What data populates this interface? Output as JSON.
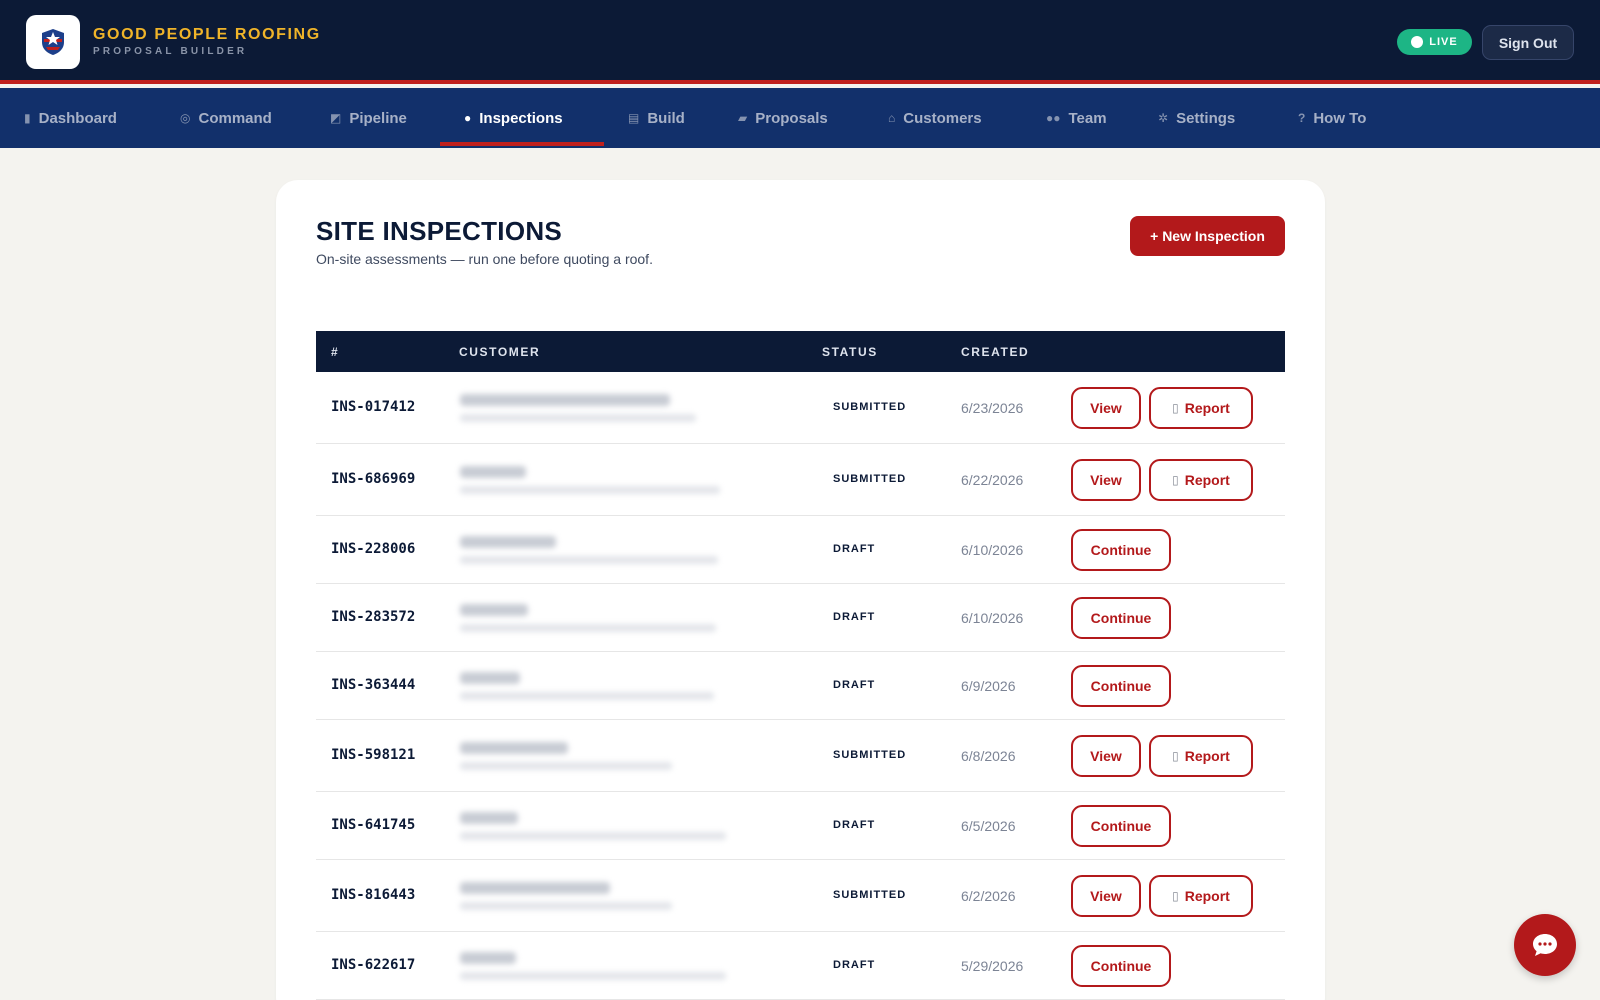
{
  "brand": {
    "title": "GOOD PEOPLE ROOFING",
    "subtitle": "PROPOSAL BUILDER",
    "logo_icon": "shield-logo-icon"
  },
  "header": {
    "live_label": "LIVE",
    "signout_label": "Sign Out"
  },
  "nav": {
    "items": [
      {
        "label": "Dashboard",
        "icon": "bar-chart-icon",
        "glyph": "▮"
      },
      {
        "label": "Command",
        "icon": "target-icon",
        "glyph": "◎"
      },
      {
        "label": "Pipeline",
        "icon": "trend-icon",
        "glyph": "◩"
      },
      {
        "label": "Inspections",
        "icon": "magnifier-icon",
        "glyph": "●",
        "active": true
      },
      {
        "label": "Build",
        "icon": "clipboard-icon",
        "glyph": "▤"
      },
      {
        "label": "Proposals",
        "icon": "folder-icon",
        "glyph": "▰"
      },
      {
        "label": "Customers",
        "icon": "house-icon",
        "glyph": "⌂"
      },
      {
        "label": "Team",
        "icon": "people-icon",
        "glyph": "●●"
      },
      {
        "label": "Settings",
        "icon": "gear-icon",
        "glyph": "✲"
      },
      {
        "label": "How To",
        "icon": "question-icon",
        "glyph": "?"
      }
    ]
  },
  "page": {
    "title": "SITE INSPECTIONS",
    "subtitle": "On-site assessments — run one before quoting a roof.",
    "new_button": "+ New Inspection"
  },
  "table": {
    "headers": [
      "#",
      "CUSTOMER",
      "STATUS",
      "CREATED"
    ],
    "rows": [
      {
        "id": "INS-017412",
        "status": "SUBMITTED",
        "created": "6/23/2026",
        "actions": [
          "View",
          "Report"
        ]
      },
      {
        "id": "INS-686969",
        "status": "SUBMITTED",
        "created": "6/22/2026",
        "actions": [
          "View",
          "Report"
        ]
      },
      {
        "id": "INS-228006",
        "status": "DRAFT",
        "created": "6/10/2026",
        "actions": [
          "Continue"
        ]
      },
      {
        "id": "INS-283572",
        "status": "DRAFT",
        "created": "6/10/2026",
        "actions": [
          "Continue"
        ]
      },
      {
        "id": "INS-363444",
        "status": "DRAFT",
        "created": "6/9/2026",
        "actions": [
          "Continue"
        ]
      },
      {
        "id": "INS-598121",
        "status": "SUBMITTED",
        "created": "6/8/2026",
        "actions": [
          "View",
          "Report"
        ]
      },
      {
        "id": "INS-641745",
        "status": "DRAFT",
        "created": "6/5/2026",
        "actions": [
          "Continue"
        ]
      },
      {
        "id": "INS-816443",
        "status": "SUBMITTED",
        "created": "6/2/2026",
        "actions": [
          "View",
          "Report"
        ]
      },
      {
        "id": "INS-622617",
        "status": "DRAFT",
        "created": "5/29/2026",
        "actions": [
          "Continue"
        ]
      }
    ]
  },
  "chat": {
    "icon": "chat-bubble-icon"
  },
  "colors": {
    "navy": "#0c1a36",
    "nav_blue": "#12306b",
    "accent_red": "#b3191b",
    "brand_gold": "#f0b429",
    "live_green": "#1db585"
  }
}
